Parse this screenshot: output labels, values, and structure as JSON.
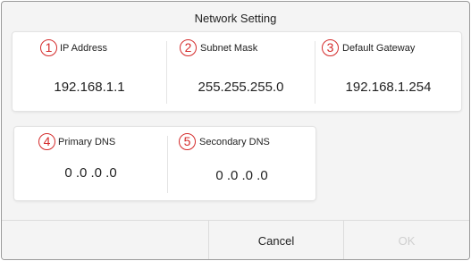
{
  "dialog": {
    "title": "Network Setting"
  },
  "fields": [
    {
      "marker": "1",
      "label": "IP Address",
      "value": "192.168.1.1"
    },
    {
      "marker": "2",
      "label": "Subnet Mask",
      "value": "255.255.255.0"
    },
    {
      "marker": "3",
      "label": "Default Gateway",
      "value": "192.168.1.254"
    },
    {
      "marker": "4",
      "label": "Primary DNS",
      "value": "0 .0 .0 .0"
    },
    {
      "marker": "5",
      "label": "Secondary DNS",
      "value": "0 .0 .0 .0"
    }
  ],
  "buttons": {
    "cancel_label": "Cancel",
    "ok_label": "OK"
  },
  "colors": {
    "marker": "#d42a2a",
    "ok_disabled": "#cfcfcf"
  }
}
